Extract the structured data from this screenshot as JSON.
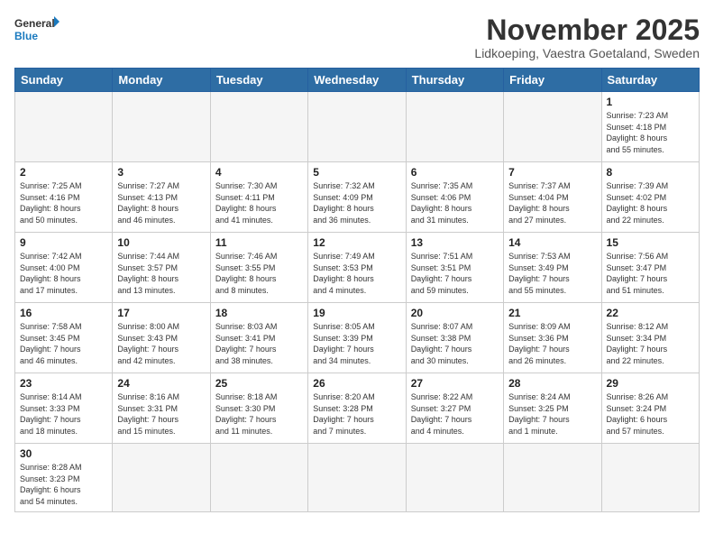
{
  "logo": {
    "text_general": "General",
    "text_blue": "Blue"
  },
  "header": {
    "month_title": "November 2025",
    "location": "Lidkoeping, Vaestra Goetaland, Sweden"
  },
  "weekdays": [
    "Sunday",
    "Monday",
    "Tuesday",
    "Wednesday",
    "Thursday",
    "Friday",
    "Saturday"
  ],
  "weeks": [
    [
      {
        "day": "",
        "info": ""
      },
      {
        "day": "",
        "info": ""
      },
      {
        "day": "",
        "info": ""
      },
      {
        "day": "",
        "info": ""
      },
      {
        "day": "",
        "info": ""
      },
      {
        "day": "",
        "info": ""
      },
      {
        "day": "1",
        "info": "Sunrise: 7:23 AM\nSunset: 4:18 PM\nDaylight: 8 hours\nand 55 minutes."
      }
    ],
    [
      {
        "day": "2",
        "info": "Sunrise: 7:25 AM\nSunset: 4:16 PM\nDaylight: 8 hours\nand 50 minutes."
      },
      {
        "day": "3",
        "info": "Sunrise: 7:27 AM\nSunset: 4:13 PM\nDaylight: 8 hours\nand 46 minutes."
      },
      {
        "day": "4",
        "info": "Sunrise: 7:30 AM\nSunset: 4:11 PM\nDaylight: 8 hours\nand 41 minutes."
      },
      {
        "day": "5",
        "info": "Sunrise: 7:32 AM\nSunset: 4:09 PM\nDaylight: 8 hours\nand 36 minutes."
      },
      {
        "day": "6",
        "info": "Sunrise: 7:35 AM\nSunset: 4:06 PM\nDaylight: 8 hours\nand 31 minutes."
      },
      {
        "day": "7",
        "info": "Sunrise: 7:37 AM\nSunset: 4:04 PM\nDaylight: 8 hours\nand 27 minutes."
      },
      {
        "day": "8",
        "info": "Sunrise: 7:39 AM\nSunset: 4:02 PM\nDaylight: 8 hours\nand 22 minutes."
      }
    ],
    [
      {
        "day": "9",
        "info": "Sunrise: 7:42 AM\nSunset: 4:00 PM\nDaylight: 8 hours\nand 17 minutes."
      },
      {
        "day": "10",
        "info": "Sunrise: 7:44 AM\nSunset: 3:57 PM\nDaylight: 8 hours\nand 13 minutes."
      },
      {
        "day": "11",
        "info": "Sunrise: 7:46 AM\nSunset: 3:55 PM\nDaylight: 8 hours\nand 8 minutes."
      },
      {
        "day": "12",
        "info": "Sunrise: 7:49 AM\nSunset: 3:53 PM\nDaylight: 8 hours\nand 4 minutes."
      },
      {
        "day": "13",
        "info": "Sunrise: 7:51 AM\nSunset: 3:51 PM\nDaylight: 7 hours\nand 59 minutes."
      },
      {
        "day": "14",
        "info": "Sunrise: 7:53 AM\nSunset: 3:49 PM\nDaylight: 7 hours\nand 55 minutes."
      },
      {
        "day": "15",
        "info": "Sunrise: 7:56 AM\nSunset: 3:47 PM\nDaylight: 7 hours\nand 51 minutes."
      }
    ],
    [
      {
        "day": "16",
        "info": "Sunrise: 7:58 AM\nSunset: 3:45 PM\nDaylight: 7 hours\nand 46 minutes."
      },
      {
        "day": "17",
        "info": "Sunrise: 8:00 AM\nSunset: 3:43 PM\nDaylight: 7 hours\nand 42 minutes."
      },
      {
        "day": "18",
        "info": "Sunrise: 8:03 AM\nSunset: 3:41 PM\nDaylight: 7 hours\nand 38 minutes."
      },
      {
        "day": "19",
        "info": "Sunrise: 8:05 AM\nSunset: 3:39 PM\nDaylight: 7 hours\nand 34 minutes."
      },
      {
        "day": "20",
        "info": "Sunrise: 8:07 AM\nSunset: 3:38 PM\nDaylight: 7 hours\nand 30 minutes."
      },
      {
        "day": "21",
        "info": "Sunrise: 8:09 AM\nSunset: 3:36 PM\nDaylight: 7 hours\nand 26 minutes."
      },
      {
        "day": "22",
        "info": "Sunrise: 8:12 AM\nSunset: 3:34 PM\nDaylight: 7 hours\nand 22 minutes."
      }
    ],
    [
      {
        "day": "23",
        "info": "Sunrise: 8:14 AM\nSunset: 3:33 PM\nDaylight: 7 hours\nand 18 minutes."
      },
      {
        "day": "24",
        "info": "Sunrise: 8:16 AM\nSunset: 3:31 PM\nDaylight: 7 hours\nand 15 minutes."
      },
      {
        "day": "25",
        "info": "Sunrise: 8:18 AM\nSunset: 3:30 PM\nDaylight: 7 hours\nand 11 minutes."
      },
      {
        "day": "26",
        "info": "Sunrise: 8:20 AM\nSunset: 3:28 PM\nDaylight: 7 hours\nand 7 minutes."
      },
      {
        "day": "27",
        "info": "Sunrise: 8:22 AM\nSunset: 3:27 PM\nDaylight: 7 hours\nand 4 minutes."
      },
      {
        "day": "28",
        "info": "Sunrise: 8:24 AM\nSunset: 3:25 PM\nDaylight: 7 hours\nand 1 minute."
      },
      {
        "day": "29",
        "info": "Sunrise: 8:26 AM\nSunset: 3:24 PM\nDaylight: 6 hours\nand 57 minutes."
      }
    ],
    [
      {
        "day": "30",
        "info": "Sunrise: 8:28 AM\nSunset: 3:23 PM\nDaylight: 6 hours\nand 54 minutes."
      },
      {
        "day": "",
        "info": ""
      },
      {
        "day": "",
        "info": ""
      },
      {
        "day": "",
        "info": ""
      },
      {
        "day": "",
        "info": ""
      },
      {
        "day": "",
        "info": ""
      },
      {
        "day": "",
        "info": ""
      }
    ]
  ]
}
